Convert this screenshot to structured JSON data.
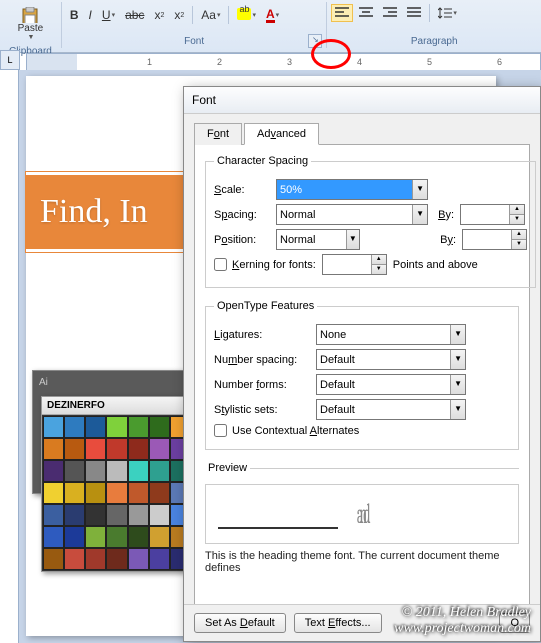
{
  "ribbon": {
    "clipboard": {
      "title": "Clipboard",
      "paste": "Paste"
    },
    "font": {
      "title": "Font"
    },
    "paragraph": {
      "title": "Paragraph"
    }
  },
  "ruler_tab": "L",
  "banner_text": "Find, In",
  "ai_label": "Ai",
  "swatch_title": "DEZINERFO",
  "dialog": {
    "title": "Font",
    "tabs": {
      "font": "Font",
      "advanced": "Advanced"
    },
    "char_spacing": {
      "legend": "Character Spacing",
      "scale_lbl": "Scale:",
      "scale_val": "50%",
      "spacing_lbl": "Spacing:",
      "spacing_val": "Normal",
      "by_lbl": "By:",
      "spacing_by": "",
      "position_lbl": "Position:",
      "position_val": "Normal",
      "position_by": "",
      "kerning_lbl": "Kerning for fonts:",
      "kerning_val": "",
      "points_lbl": "Points and above"
    },
    "opentype": {
      "legend": "OpenType Features",
      "ligatures_lbl": "Ligatures:",
      "ligatures_val": "None",
      "numspacing_lbl": "Number spacing:",
      "numspacing_val": "Default",
      "numforms_lbl": "Number forms:",
      "numforms_val": "Default",
      "stylistic_lbl": "Stylistic sets:",
      "stylistic_val": "Default",
      "contextual_lbl": "Use Contextual Alternates"
    },
    "preview": {
      "legend": "Preview",
      "sample": "and",
      "hint": "This is the heading theme font. The current document theme defines "
    },
    "footer": {
      "default": "Set As Default",
      "effects": "Text Effects...",
      "ok": "O"
    }
  },
  "watermark": {
    "line1": "© 2011, Helen Bradley",
    "line2": "www.projectwoman.com"
  },
  "swatches": [
    "#4aa3df",
    "#2e7bbf",
    "#1c5a99",
    "#7fd13b",
    "#4a9b2e",
    "#2e6b1c",
    "#f0a030",
    "#d97b20",
    "#b85a10",
    "#e84c3d",
    "#c0392b",
    "#8e2a1c",
    "#9b59b6",
    "#6b3fa0",
    "#4a2c70",
    "#555",
    "#888",
    "#bbb",
    "#3bd1c0",
    "#2ea090",
    "#1c7060",
    "#f0d030",
    "#d9b020",
    "#b89010",
    "#e87c3d",
    "#c0592b",
    "#8e3a1c",
    "#5b79b6",
    "#3b5fa0",
    "#2a3c70",
    "#333",
    "#666",
    "#999",
    "#ccc",
    "#4a83df",
    "#2e5bbf",
    "#1c3a99",
    "#7fb13b",
    "#4a7b2e",
    "#2e4b1c",
    "#d0a030",
    "#b97b20",
    "#985a10",
    "#c84c3d",
    "#a0392b",
    "#6e2a1c",
    "#7b59b6",
    "#4b3fa0",
    "#2a2c70"
  ]
}
